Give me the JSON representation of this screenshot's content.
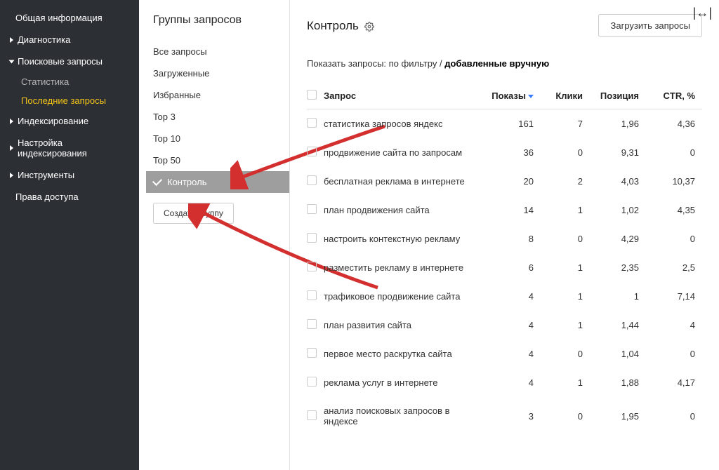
{
  "sidebar": {
    "items": [
      {
        "label": "Общая информация",
        "type": "plain"
      },
      {
        "label": "Диагностика",
        "type": "caret"
      },
      {
        "label": "Поисковые запросы",
        "type": "caret-open",
        "children": [
          {
            "label": "Статистика"
          },
          {
            "label": "Последние запросы",
            "active": true
          }
        ]
      },
      {
        "label": "Индексирование",
        "type": "caret"
      },
      {
        "label": "Настройка индексирования",
        "type": "caret"
      },
      {
        "label": "Инструменты",
        "type": "caret"
      },
      {
        "label": "Права доступа",
        "type": "plain"
      }
    ]
  },
  "groups": {
    "title": "Группы запросов",
    "items": [
      {
        "label": "Все запросы"
      },
      {
        "label": "Загруженные"
      },
      {
        "label": "Избранные"
      },
      {
        "label": "Top 3"
      },
      {
        "label": "Top 10"
      },
      {
        "label": "Top 50"
      },
      {
        "label": "Контроль",
        "selected": true
      }
    ],
    "create_btn": "Создать группу"
  },
  "main": {
    "title": "Контроль",
    "load_btn": "Загрузить запросы",
    "filter_prefix": "Показать запросы: ",
    "filter_link": "по фильтру",
    "filter_sep": " / ",
    "filter_active": "добавленные вручную",
    "columns": {
      "query": "Запрос",
      "shows": "Показы",
      "clicks": "Клики",
      "position": "Позиция",
      "ctr": "CTR, %"
    },
    "rows": [
      {
        "query": "статистика запросов яндекс",
        "shows": "161",
        "clicks": "7",
        "position": "1,96",
        "ctr": "4,36"
      },
      {
        "query": "продвижение сайта по запросам",
        "shows": "36",
        "clicks": "0",
        "position": "9,31",
        "ctr": "0"
      },
      {
        "query": "бесплатная реклама в интернете",
        "shows": "20",
        "clicks": "2",
        "position": "4,03",
        "ctr": "10,37"
      },
      {
        "query": "план продвижения сайта",
        "shows": "14",
        "clicks": "1",
        "position": "1,02",
        "ctr": "4,35"
      },
      {
        "query": "настроить контекстную рекламу",
        "shows": "8",
        "clicks": "0",
        "position": "4,29",
        "ctr": "0"
      },
      {
        "query": "разместить рекламу в интернете",
        "shows": "6",
        "clicks": "1",
        "position": "2,35",
        "ctr": "2,5"
      },
      {
        "query": "трафиковое продвижение сайта",
        "shows": "4",
        "clicks": "1",
        "position": "1",
        "ctr": "7,14"
      },
      {
        "query": "план развития сайта",
        "shows": "4",
        "clicks": "1",
        "position": "1,44",
        "ctr": "4"
      },
      {
        "query": "первое место раскрутка сайта",
        "shows": "4",
        "clicks": "0",
        "position": "1,04",
        "ctr": "0"
      },
      {
        "query": "реклама услуг в интернете",
        "shows": "4",
        "clicks": "1",
        "position": "1,88",
        "ctr": "4,17"
      },
      {
        "query": "анализ поисковых запросов в яндексе",
        "shows": "3",
        "clicks": "0",
        "position": "1,95",
        "ctr": "0"
      }
    ]
  }
}
